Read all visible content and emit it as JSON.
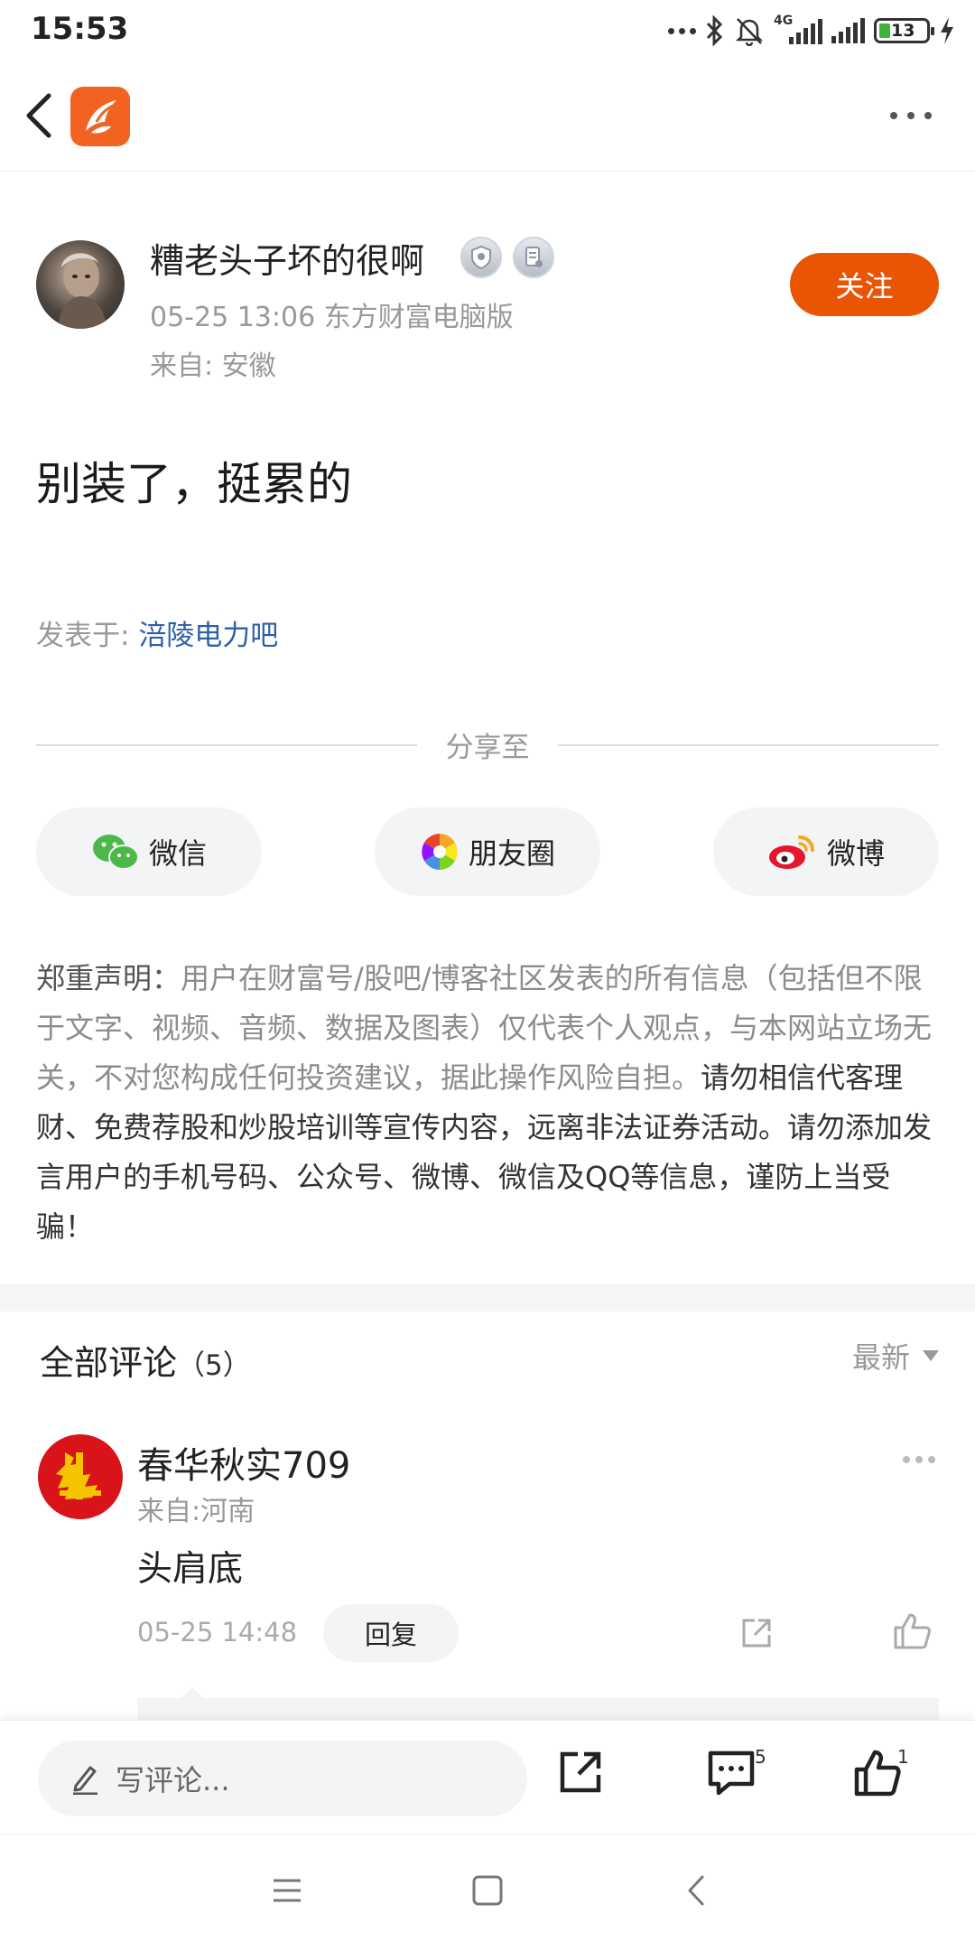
{
  "status_bar": {
    "time": "15:53",
    "network_label": "4G",
    "battery": "13"
  },
  "post": {
    "author": {
      "name": "糟老头子坏的很啊",
      "datetime_source": "05-25 13:06 东方财富电脑版",
      "location": "来自: 安徽"
    },
    "follow_label": "关注",
    "body": "别装了，挺累的",
    "posted_in_label": "发表于:",
    "posted_in_link": "涪陵电力吧"
  },
  "share": {
    "title": "分享至",
    "buttons": [
      {
        "label": "微信",
        "icon": "wechat-icon"
      },
      {
        "label": "朋友圈",
        "icon": "moments-icon"
      },
      {
        "label": "微博",
        "icon": "weibo-icon"
      }
    ]
  },
  "disclaimer": {
    "lead": "郑重声明：",
    "part1": "用户在财富号/股吧/博客社区发表的所有信息（包括但不限于文字、视频、音频、数据及图表）仅代表个人观点，与本网站立场无关，不对您构成任何投资建议，据此操作风险自担。",
    "part2": "请勿相信代客理财、免费荐股和炒股培训等宣传内容，远离非法证券活动。请勿添加发言用户的手机号码、公众号、微博、微信及QQ等信息，谨防上当受骗！"
  },
  "comments": {
    "title": "全部评论",
    "count": "（5）",
    "sort_label": "最新",
    "items": [
      {
        "name": "春华秋实709",
        "from": "来自:河南",
        "text": "头肩底",
        "time": "05-25 14:48",
        "reply_label": "回复"
      }
    ]
  },
  "bottom_bar": {
    "write_placeholder": "写评论...",
    "comment_count": "5",
    "like_count": "1"
  },
  "colors": {
    "accent": "#ea5504",
    "link": "#2d5faa",
    "muted": "#999999"
  }
}
